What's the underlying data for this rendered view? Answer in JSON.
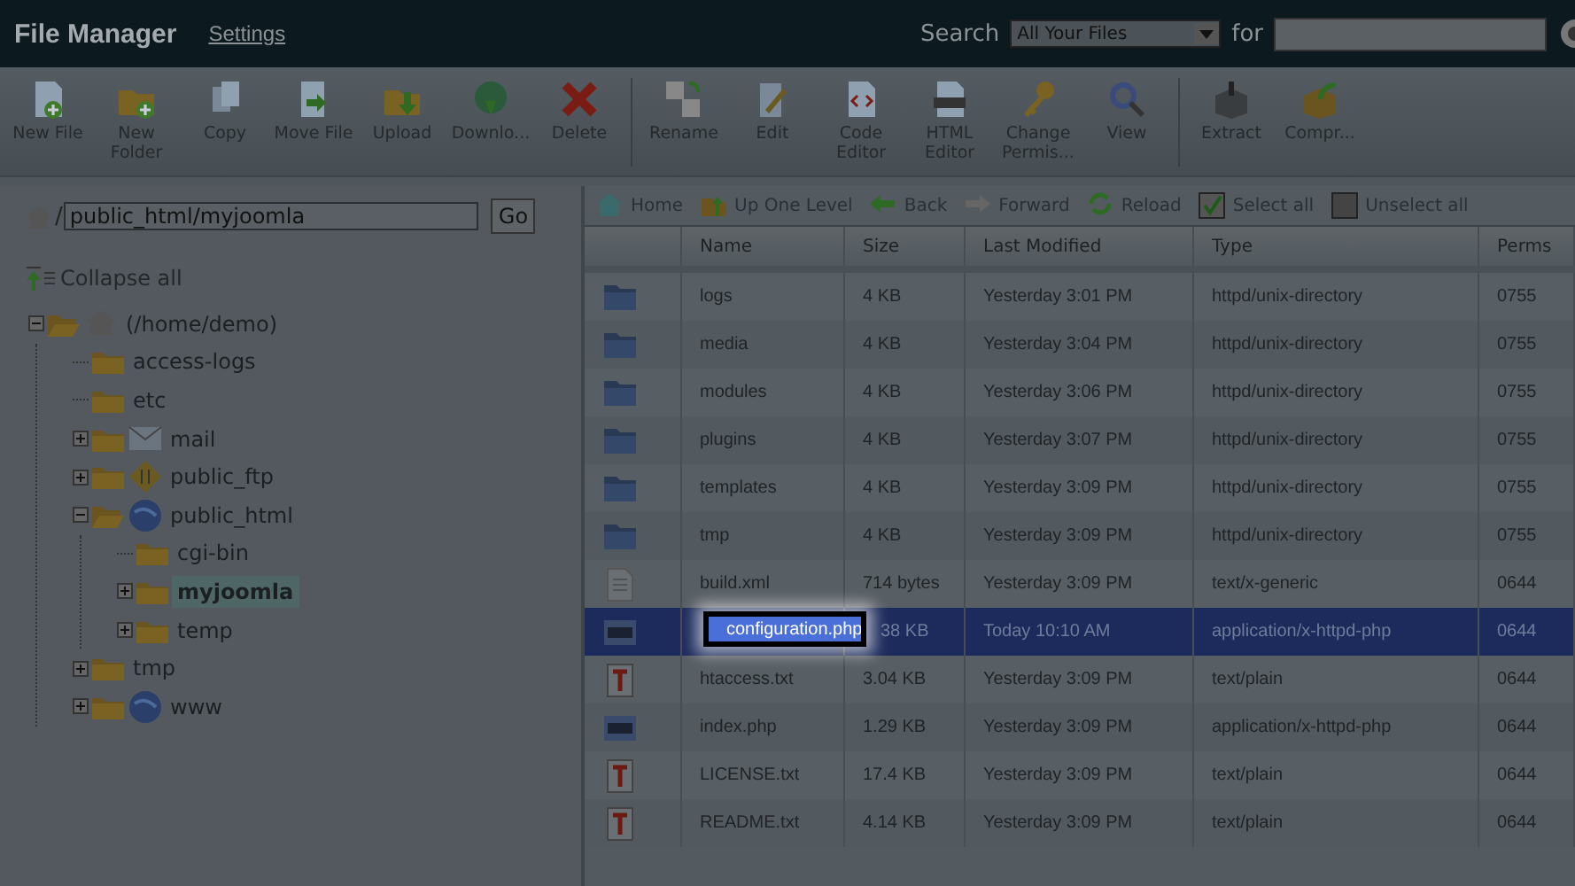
{
  "header": {
    "title": "File Manager",
    "settings_link": "Settings",
    "search_label": "Search",
    "search_scope": "All Your Files",
    "for_label": "for"
  },
  "toolbar": [
    [
      {
        "label": "New File"
      },
      {
        "label": "New Folder"
      },
      {
        "label": "Copy"
      },
      {
        "label": "Move File"
      },
      {
        "label": "Upload"
      },
      {
        "label": "Downlo..."
      },
      {
        "label": "Delete"
      }
    ],
    [
      {
        "label": "Rename"
      },
      {
        "label": "Edit"
      },
      {
        "label": "Code Editor"
      },
      {
        "label": "HTML Editor"
      },
      {
        "label": "Change Permis..."
      },
      {
        "label": "View"
      }
    ],
    [
      {
        "label": "Extract"
      },
      {
        "label": "Compr..."
      }
    ]
  ],
  "path": {
    "prefix": "/",
    "value": "public_html/myjoomla",
    "go": "Go"
  },
  "tree": {
    "collapse_all": "Collapse all",
    "nodes": [
      {
        "label": "(/home/demo)",
        "kind": "home",
        "expanded": true,
        "selected": false,
        "children": [
          {
            "label": "access-logs",
            "kind": "folder",
            "selected": false
          },
          {
            "label": "etc",
            "kind": "folder",
            "selected": false
          },
          {
            "label": "mail",
            "kind": "mail",
            "expanded": false,
            "selected": false
          },
          {
            "label": "public_ftp",
            "kind": "ftp",
            "expanded": false,
            "selected": false
          },
          {
            "label": "public_html",
            "kind": "web",
            "expanded": true,
            "selected": false,
            "children": [
              {
                "label": "cgi-bin",
                "kind": "folder",
                "selected": false
              },
              {
                "label": "myjoomla",
                "kind": "folder",
                "expanded": false,
                "selected": true
              },
              {
                "label": "temp",
                "kind": "folder",
                "expanded": false,
                "selected": false
              }
            ]
          },
          {
            "label": "tmp",
            "kind": "folder",
            "expanded": false,
            "selected": false
          },
          {
            "label": "www",
            "kind": "web",
            "expanded": false,
            "selected": false
          }
        ]
      }
    ]
  },
  "nav": [
    {
      "label": "Home"
    },
    {
      "label": "Up One Level"
    },
    {
      "label": "Back"
    },
    {
      "label": "Forward"
    },
    {
      "label": "Reload"
    },
    {
      "label": "Select all"
    },
    {
      "label": "Unselect all"
    }
  ],
  "table": {
    "columns": [
      "Name",
      "Size",
      "Last Modified",
      "Type",
      "Perms"
    ],
    "rows": [
      {
        "kind": "folder",
        "name": "logs",
        "size": "4 KB",
        "modified": "Yesterday 3:01 PM",
        "type": "httpd/unix-directory",
        "perms": "0755",
        "selected": false,
        "editing": false
      },
      {
        "kind": "folder",
        "name": "media",
        "size": "4 KB",
        "modified": "Yesterday 3:04 PM",
        "type": "httpd/unix-directory",
        "perms": "0755",
        "selected": false,
        "editing": false
      },
      {
        "kind": "folder",
        "name": "modules",
        "size": "4 KB",
        "modified": "Yesterday 3:06 PM",
        "type": "httpd/unix-directory",
        "perms": "0755",
        "selected": false,
        "editing": false
      },
      {
        "kind": "folder",
        "name": "plugins",
        "size": "4 KB",
        "modified": "Yesterday 3:07 PM",
        "type": "httpd/unix-directory",
        "perms": "0755",
        "selected": false,
        "editing": false
      },
      {
        "kind": "folder",
        "name": "templates",
        "size": "4 KB",
        "modified": "Yesterday 3:09 PM",
        "type": "httpd/unix-directory",
        "perms": "0755",
        "selected": false,
        "editing": false
      },
      {
        "kind": "folder",
        "name": "tmp",
        "size": "4 KB",
        "modified": "Yesterday 3:09 PM",
        "type": "httpd/unix-directory",
        "perms": "0755",
        "selected": false,
        "editing": false
      },
      {
        "kind": "generic",
        "name": "build.xml",
        "size": "714 bytes",
        "modified": "Yesterday 3:09 PM",
        "type": "text/x-generic",
        "perms": "0644",
        "selected": false,
        "editing": false
      },
      {
        "kind": "php",
        "name": "configuration.php",
        "size": "38 KB",
        "modified": "Today 10:10 AM",
        "type": "application/x-httpd-php",
        "perms": "0644",
        "selected": true,
        "editing": true
      },
      {
        "kind": "text",
        "name": "htaccess.txt",
        "size": "3.04 KB",
        "modified": "Yesterday 3:09 PM",
        "type": "text/plain",
        "perms": "0644",
        "selected": false,
        "editing": false
      },
      {
        "kind": "php",
        "name": "index.php",
        "size": "1.29 KB",
        "modified": "Yesterday 3:09 PM",
        "type": "application/x-httpd-php",
        "perms": "0644",
        "selected": false,
        "editing": false
      },
      {
        "kind": "text",
        "name": "LICENSE.txt",
        "size": "17.4 KB",
        "modified": "Yesterday 3:09 PM",
        "type": "text/plain",
        "perms": "0644",
        "selected": false,
        "editing": false
      },
      {
        "kind": "text",
        "name": "README.txt",
        "size": "4.14 KB",
        "modified": "Yesterday 3:09 PM",
        "type": "text/plain",
        "perms": "0644",
        "selected": false,
        "editing": false
      }
    ]
  }
}
